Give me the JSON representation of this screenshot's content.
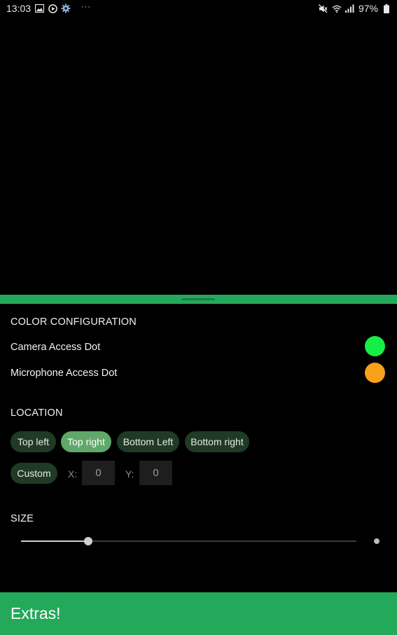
{
  "status_bar": {
    "time": "13:03",
    "battery": "97%",
    "left_icons": [
      "image-icon",
      "play-icon",
      "settings-gear-icon"
    ],
    "right_icons": [
      "mute-icon",
      "wifi-icon",
      "signal-icon",
      "battery-icon"
    ],
    "more": "···"
  },
  "color_config": {
    "title": "COLOR CONFIGURATION",
    "camera_label": "Camera Access Dot",
    "camera_color": "#16ee45",
    "mic_label": "Microphone Access Dot",
    "mic_color": "#f9a01b"
  },
  "location": {
    "title": "LOCATION",
    "options": [
      "Top left",
      "Top right",
      "Bottom Left",
      "Bottom right"
    ],
    "selected": "Top right",
    "custom_label": "Custom",
    "x_label": "X:",
    "x_value": "0",
    "y_label": "Y:",
    "y_value": "0"
  },
  "size": {
    "title": "SIZE",
    "value_fraction": 0.2
  },
  "extras": {
    "label": "Extras!"
  },
  "colors": {
    "accent": "#24a95a",
    "chip_bg": "#1f3a25",
    "chip_selected_bg": "#5fa869"
  }
}
